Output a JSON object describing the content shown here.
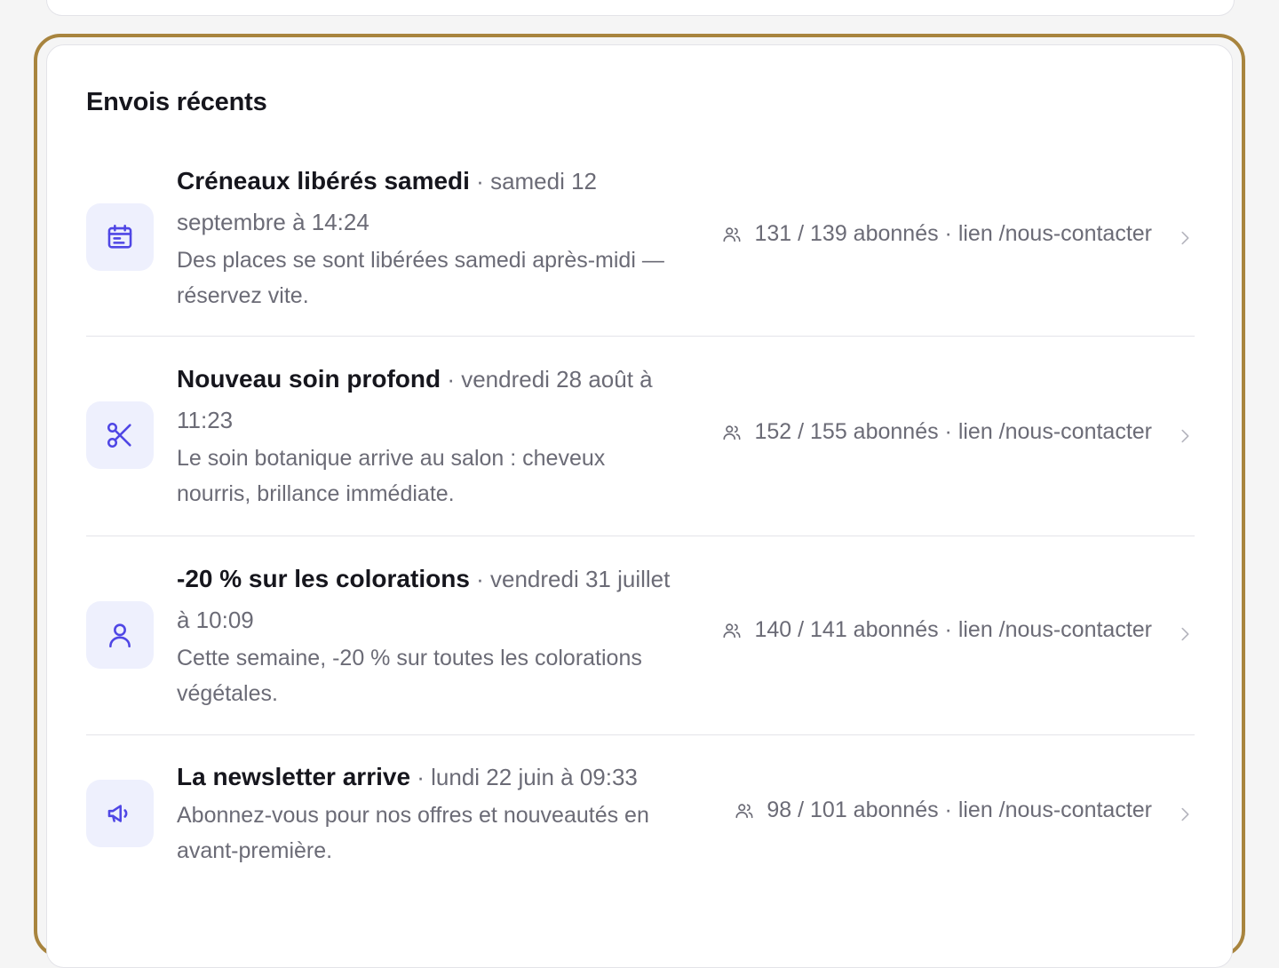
{
  "section": {
    "title": "Envois récents"
  },
  "sends": [
    {
      "icon": "calendar-icon",
      "title": "Créneaux libérés samedi",
      "date": "samedi 12 septembre à 14:24",
      "description": "Des places se sont libérées samedi après-midi — réservez vite.",
      "stats": "131 / 139 abonnés · lien /nous-contacter"
    },
    {
      "icon": "scissors-icon",
      "title": "Nouveau soin profond",
      "date": "vendredi 28 août à 11:23",
      "description": "Le soin botanique arrive au salon : cheveux nourris, brillance immédiate.",
      "stats": "152 / 155 abonnés · lien /nous-contacter"
    },
    {
      "icon": "user-icon",
      "title": "-20 % sur les colorations",
      "date": "vendredi 31 juillet à 10:09",
      "description": "Cette semaine, -20 % sur toutes les colorations végétales.",
      "stats": "140 / 141 abonnés · lien /nous-contacter"
    },
    {
      "icon": "megaphone-icon",
      "title": "La newsletter arrive",
      "date": "lundi 22 juin à 09:33",
      "description": "Abonnez-vous pour nos offres et nouveautés en avant-première.",
      "stats": "98 / 101 abonnés · lien /nous-contacter"
    }
  ],
  "colors": {
    "accent": "#4f46e5",
    "icon_bg": "#eef0fd",
    "focus_ring": "#a8843e",
    "muted_text": "#6b6b76",
    "heading_text": "#16161d"
  }
}
